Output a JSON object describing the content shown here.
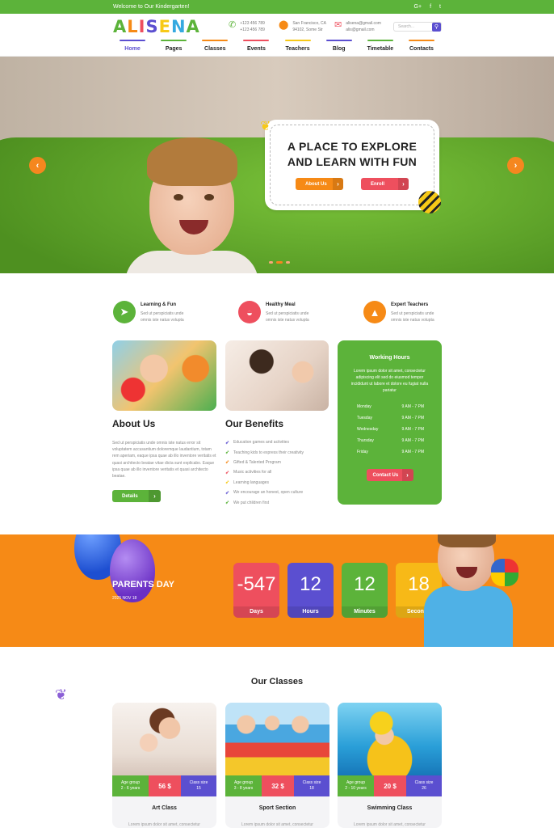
{
  "topbar": {
    "welcome": "Welcome to Our Kindergarten!",
    "social": [
      "G+",
      "f",
      "t"
    ]
  },
  "header": {
    "logo": [
      "A",
      "L",
      "I",
      "S",
      "E",
      "N",
      "A"
    ],
    "logo_colors": [
      "#5cb33a",
      "#f68a16",
      "#ee4f5e",
      "#5b4fd0",
      "#f7c917",
      "#35a9e0",
      "#5cb33a"
    ],
    "phone": [
      "+123 456 789",
      "+123 456 789"
    ],
    "address": [
      "San Francisco, CA",
      "94102, Some Str"
    ],
    "email": [
      "alisena@gmail.com",
      "alis@gmail.com"
    ],
    "search_placeholder": "Search..."
  },
  "nav": [
    {
      "label": "Home",
      "color": "#5b4fd0"
    },
    {
      "label": "Pages",
      "color": "#5cb33a"
    },
    {
      "label": "Classes",
      "color": "#f68a16"
    },
    {
      "label": "Events",
      "color": "#ee4f5e"
    },
    {
      "label": "Teachers",
      "color": "#f7c917"
    },
    {
      "label": "Blog",
      "color": "#5b4fd0"
    },
    {
      "label": "Timetable",
      "color": "#5cb33a"
    },
    {
      "label": "Contacts",
      "color": "#f68a16"
    }
  ],
  "hero": {
    "title_line1": "A PLACE TO EXPLORE",
    "title_line2": "AND LEARN WITH FUN",
    "btn_about": "About Us",
    "btn_enroll": "Enroll",
    "prev": "‹",
    "next": "›"
  },
  "features": [
    {
      "title": "Learning & Fun",
      "line1": "Sed ut perspiciatis unde",
      "line2": "omnis iste natus volupta",
      "color": "#5cb33a",
      "icon": "paper-plane-icon"
    },
    {
      "title": "Healthy Meal",
      "line1": "Sed ut perspiciatis unde",
      "line2": "omnis iste natus volupta",
      "color": "#ee4f5e",
      "icon": "bowl-icon"
    },
    {
      "title": "Expert Teachers",
      "line1": "Sed ut perspiciatis unde",
      "line2": "omnis iste natus volupta",
      "color": "#f68a16",
      "icon": "graduation-cap-icon"
    }
  ],
  "about": {
    "title": "About Us",
    "text": "Sed ut perspiciatis unde omnis iste natus error sit voluptatem accusantium doloremque laudantium, totam rem aperiam, eaque ipsa quae ab illo inventore veritatis et quasi architecto beatae vitae dicta sunt explicabo. Eaque ipsa quae ab illo inventore veritatis et quasi architecto beatae.",
    "button": "Details"
  },
  "benefits": {
    "title": "Our Benefits",
    "items": [
      {
        "text": "Education games and activities",
        "color": "#5b4fd0"
      },
      {
        "text": "Teaching kids to express their creativity",
        "color": "#5cb33a"
      },
      {
        "text": "Gifted & Talented Program",
        "color": "#f68a16"
      },
      {
        "text": "Music activities for all",
        "color": "#ee4f5e"
      },
      {
        "text": "Learning languages",
        "color": "#f7c917"
      },
      {
        "text": "We encourage an honest, open culture",
        "color": "#5b4fd0"
      },
      {
        "text": "We put children first",
        "color": "#5cb33a"
      }
    ]
  },
  "hours": {
    "title": "Working Hours",
    "text": "Lorem ipsum dolor sit amet, consectetur adipiscing elit sed do eiusmod tempor incididunt ut labore et dolore eu fugiat nulla pariatur",
    "rows": [
      {
        "day": "Monday",
        "time": "9 AM - 7 PM"
      },
      {
        "day": "Tuesday",
        "time": "9 AM - 7 PM"
      },
      {
        "day": "Wednesday",
        "time": "9 AM - 7 PM"
      },
      {
        "day": "Thursday",
        "time": "9 AM - 7 PM"
      },
      {
        "day": "Friday",
        "time": "9 AM - 7 PM"
      }
    ],
    "button": "Contact Us"
  },
  "event": {
    "title": "PARENTS DAY",
    "date": "2025 NOV 18",
    "units": [
      {
        "value": "-547",
        "label": "Days",
        "color": "#ee4f5e"
      },
      {
        "value": "12",
        "label": "Hours",
        "color": "#5b4fd0"
      },
      {
        "value": "12",
        "label": "Minutes",
        "color": "#5cb33a"
      },
      {
        "value": "18",
        "label": "Seconds",
        "color": "#f7b917"
      }
    ]
  },
  "classes": {
    "title": "Our Classes",
    "items": [
      {
        "age_label": "Age group",
        "age": "2 - 6 years",
        "price": "56 $",
        "size_label": "Class size",
        "size": "15",
        "name": "Art Class",
        "text": "Lorem ipsum dolor sit amet, consectetur"
      },
      {
        "age_label": "Age group",
        "age": "3 - 8 years",
        "price": "32 $",
        "size_label": "Class size",
        "size": "18",
        "name": "Sport Section",
        "text": "Lorem ipsum dolor sit amet, consectetur"
      },
      {
        "age_label": "Age group",
        "age": "2 - 10 years",
        "price": "20 $",
        "size_label": "Class size",
        "size": "26",
        "name": "Swimming Class",
        "text": "Lorem ipsum dolor sit amet, consectetur"
      }
    ]
  }
}
